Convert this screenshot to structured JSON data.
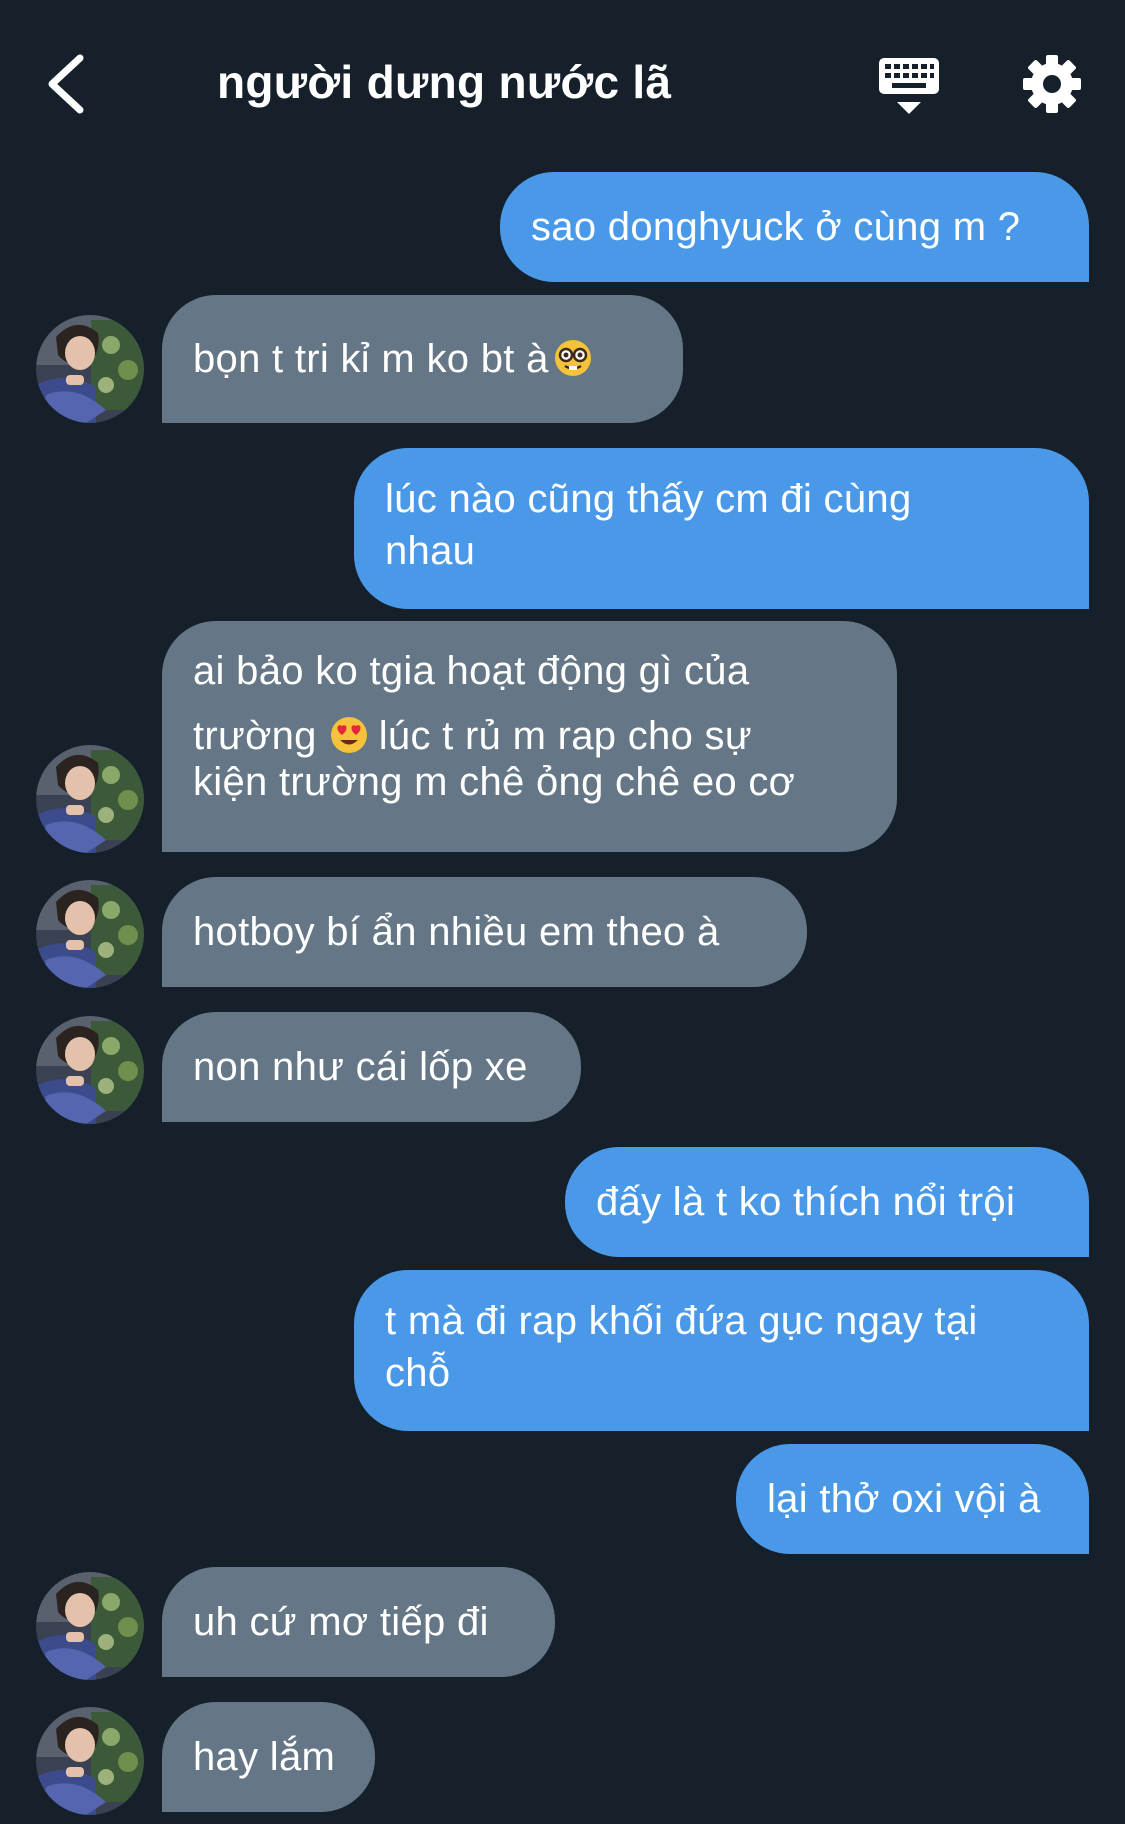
{
  "header": {
    "title": "người dưng nước lã"
  },
  "icons": {
    "back": "chevron-left-icon",
    "keyboard": "keyboard-icon",
    "settings": "gear-icon",
    "nerd": "nerd-face-emoji",
    "heart_eyes": "heart-eyes-emoji"
  },
  "colors": {
    "background": "#15202b",
    "sent_bubble": "#4a99e9",
    "received_bubble": "#657786",
    "text": "#ffffff"
  },
  "messages": [
    {
      "side": "sent",
      "lines": [
        "sao donghyuck ở cùng m ?"
      ]
    },
    {
      "side": "received",
      "lines": [
        "bọn t tri kỉ m ko bt à"
      ],
      "emoji": "nerd-face-emoji"
    },
    {
      "side": "sent",
      "lines": [
        "lúc nào cũng thấy cm đi cùng",
        "nhau"
      ]
    },
    {
      "side": "received",
      "lines": [
        "ai bảo ko tgia hoạt động gì của",
        "trường",
        "lúc t rủ m rap cho sự",
        "kiện trường m chê ỏng chê eo cơ"
      ],
      "emoji": "heart-eyes-emoji"
    },
    {
      "side": "received",
      "lines": [
        "hotboy bí ẩn nhiều em theo à"
      ]
    },
    {
      "side": "received",
      "lines": [
        "non như cái lốp xe"
      ]
    },
    {
      "side": "sent",
      "lines": [
        "đấy là t ko thích nổi trội"
      ]
    },
    {
      "side": "sent",
      "lines": [
        "t mà đi rap khối đứa gục ngay tại",
        "chỗ"
      ]
    },
    {
      "side": "sent",
      "lines": [
        "lại thở oxi vội à"
      ]
    },
    {
      "side": "received",
      "lines": [
        "uh cứ mơ tiếp đi"
      ]
    },
    {
      "side": "received",
      "lines": [
        "hay lắm"
      ]
    }
  ]
}
